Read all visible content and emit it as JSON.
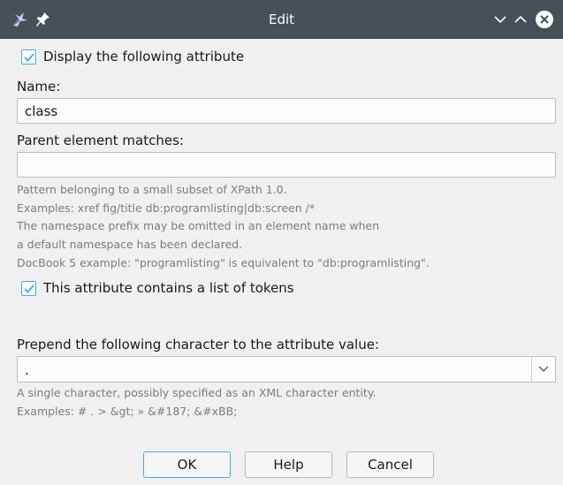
{
  "window": {
    "title": "Edit",
    "icons": [
      "app-icon",
      "pin-icon",
      "minimize-icon",
      "maximize-icon",
      "close-icon"
    ]
  },
  "display_attribute": {
    "checked": true,
    "label": "Display the following attribute"
  },
  "name": {
    "label": "Name:",
    "value": "class"
  },
  "parent": {
    "label": "Parent element matches:",
    "value": "",
    "hints": [
      "Pattern belonging to a small subset of XPath 1.0.",
      "Examples: xref fig/title db:programlisting|db:screen /*",
      "The namespace prefix may be omitted in an element name when",
      "a default namespace has been declared.",
      "DocBook 5 example: \"programlisting\" is equivalent to \"db:programlisting\"."
    ]
  },
  "tokens": {
    "checked": true,
    "label": "This attribute contains a list of tokens"
  },
  "prepend": {
    "label": "Prepend the following character to the attribute value:",
    "value": ".",
    "hints": [
      "A single character, possibly specified as an XML character entity.",
      "Examples: # . > &gt; » &#187; &#xBB;"
    ]
  },
  "buttons": {
    "ok": "OK",
    "help": "Help",
    "cancel": "Cancel"
  },
  "colors": {
    "titlebar": "#475057",
    "accent": "#3daee9",
    "background": "#f0f0f0",
    "hint_text": "#7b7c7e"
  }
}
